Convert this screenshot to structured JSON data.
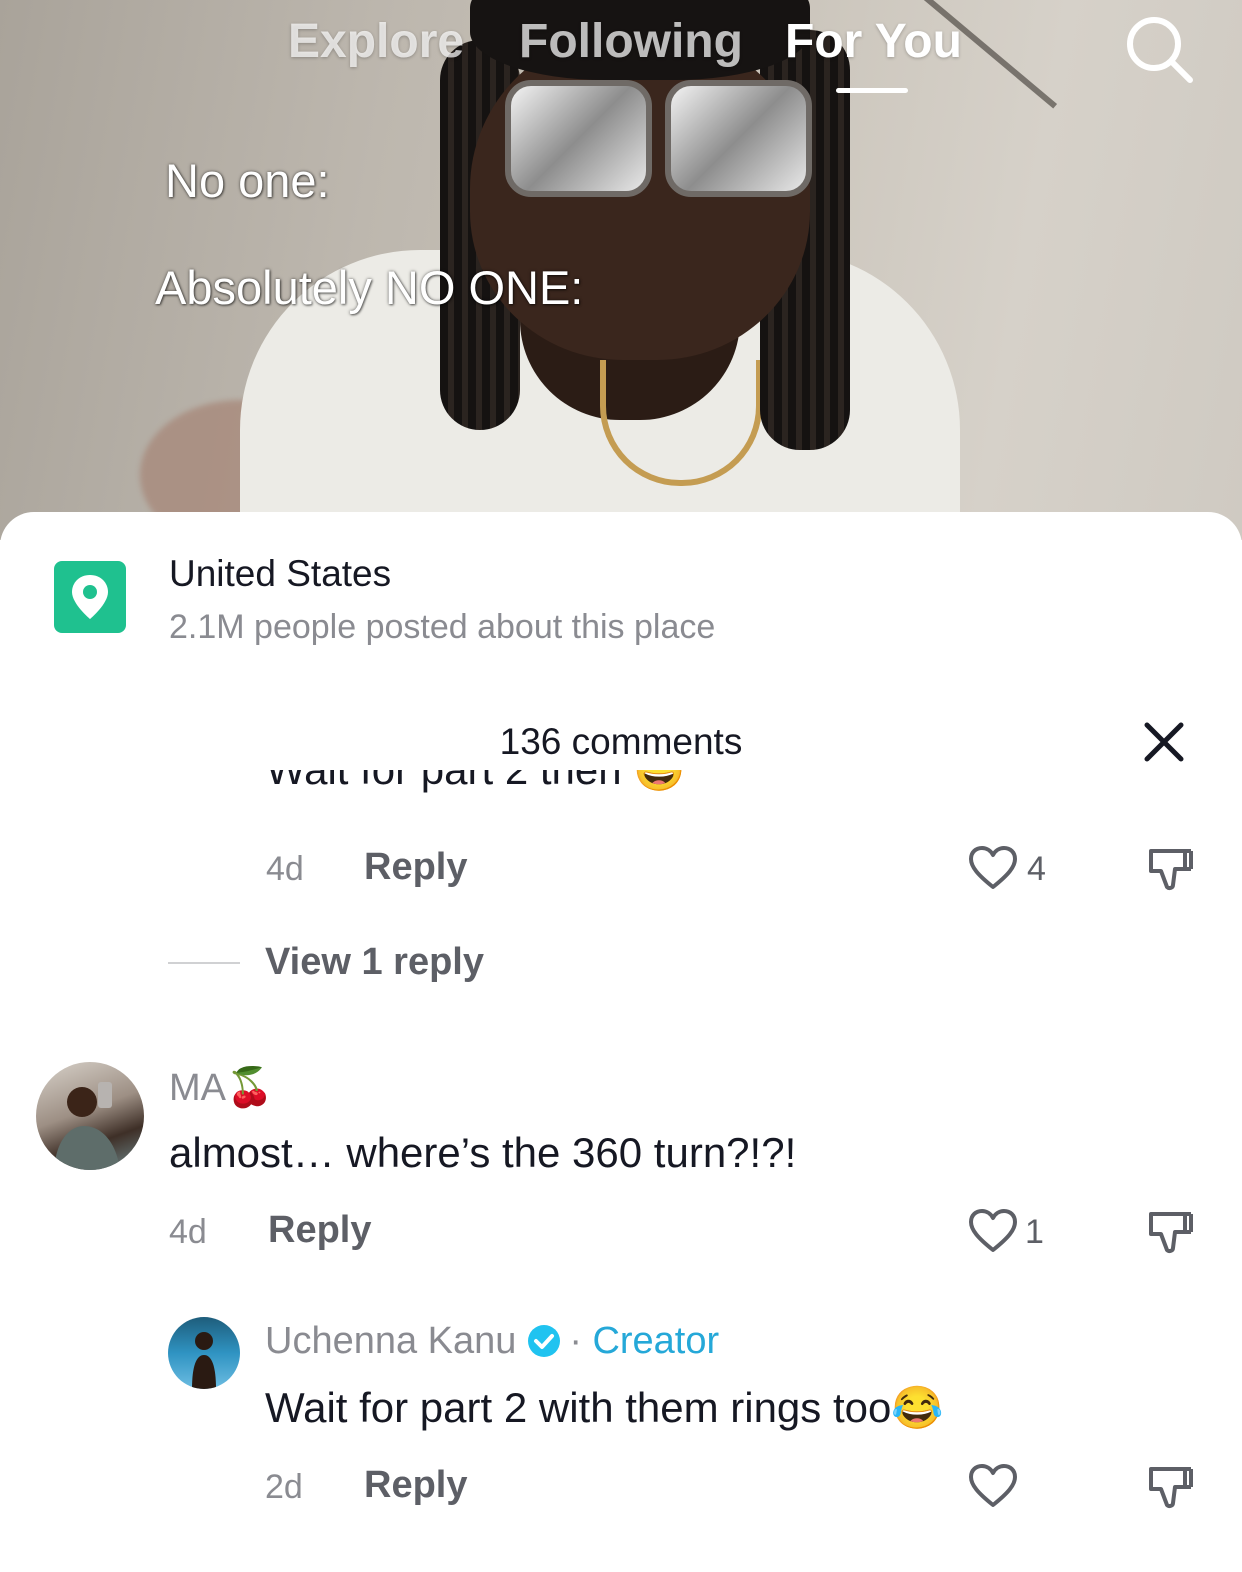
{
  "top_nav": {
    "tabs": [
      {
        "label": "Explore"
      },
      {
        "label": "Following"
      },
      {
        "label": "For You"
      }
    ],
    "active_tab": "For You"
  },
  "video": {
    "caption_line1": "No one:",
    "caption_line2": "Absolutely NO ONE:"
  },
  "location": {
    "title": "United States",
    "subtitle": "2.1M people posted about this place"
  },
  "comments_header": {
    "count_label": "136 comments"
  },
  "comments": {
    "clipped_text": "Wait for part 2 then 😅",
    "first": {
      "time": "4d",
      "reply_label": "Reply",
      "likes": "4"
    },
    "view_replies": "View 1 reply",
    "second": {
      "username": "MA",
      "username_emoji": "🍒",
      "text": "almost… where’s the 360 turn?!?!",
      "time": "4d",
      "reply_label": "Reply",
      "likes": "1"
    },
    "reply": {
      "username": "Uchenna Kanu",
      "separator": "·",
      "badge": "Creator",
      "text": "Wait for part 2 with them rings too",
      "text_emoji": "😂",
      "time": "2d",
      "reply_label": "Reply"
    }
  },
  "colors": {
    "location_badge": "#1fc18f",
    "creator_accent": "#25a8d8",
    "verified": "#20c3f0"
  }
}
